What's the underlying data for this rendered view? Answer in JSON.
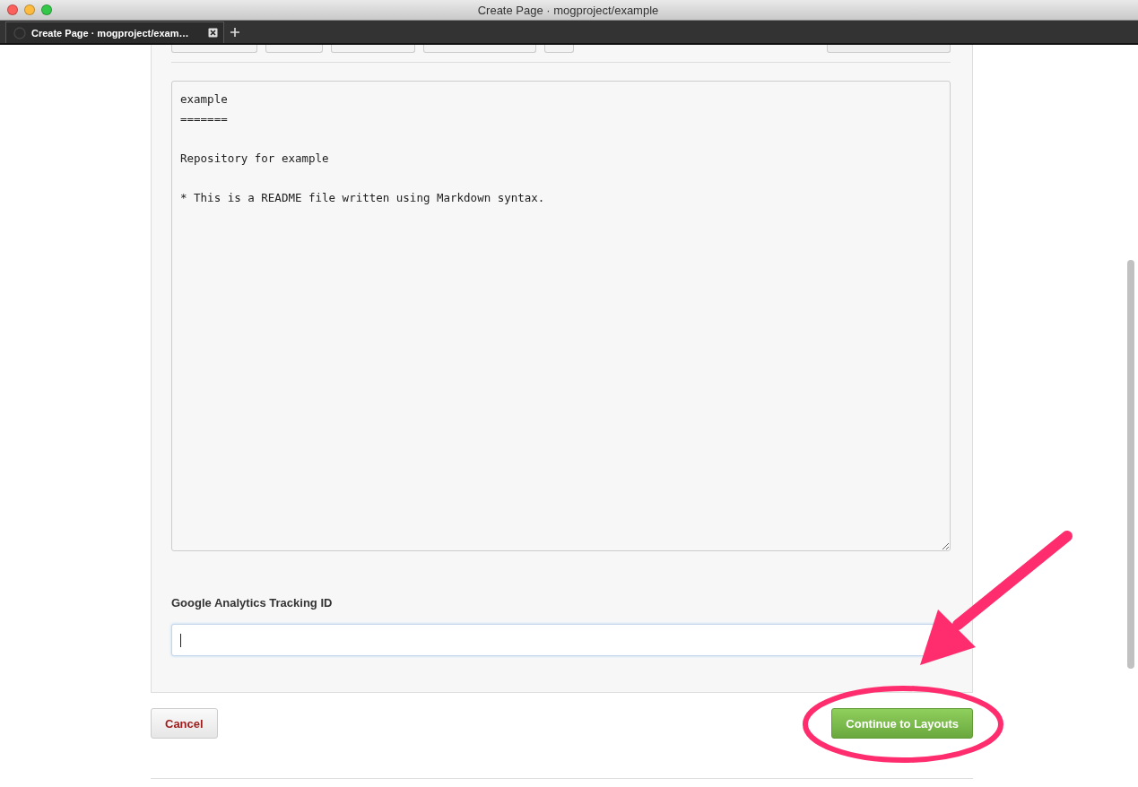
{
  "window": {
    "title": "Create Page · mogproject/example"
  },
  "tabs": [
    {
      "label": "Create Page · mogproject/exam…",
      "selected": true
    }
  ],
  "editor": {
    "content": "example\n=======\n\nRepository for example\n\n* This is a README file written using Markdown syntax."
  },
  "tracking_field": {
    "label": "Google Analytics Tracking ID",
    "focused": true
  },
  "buttons": [
    {
      "label": "Cancel",
      "kind": "cancel"
    },
    {
      "label": "Continue to Layouts",
      "kind": "primary"
    }
  ]
}
